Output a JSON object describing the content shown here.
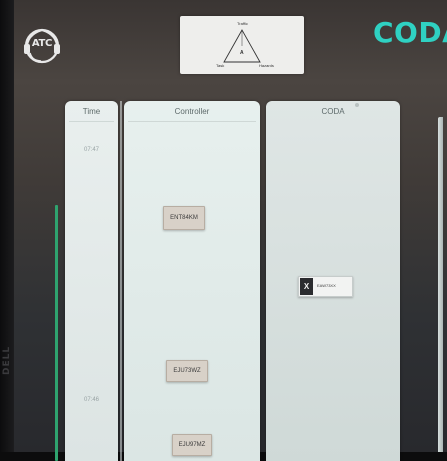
{
  "app": {
    "logo_text": "ATC",
    "title": "CODA"
  },
  "triangle": {
    "top_label": "Traffic",
    "left_label": "Task",
    "right_label": "Hazards",
    "center_label": "A"
  },
  "panels": {
    "time": {
      "header": "Time",
      "labels": [
        "07:47",
        "07:46"
      ]
    },
    "controller": {
      "header": "Controller",
      "strips": [
        "ENT84KM",
        "EJU73WZ",
        "EJU97MZ"
      ]
    },
    "coda": {
      "header": "CODA",
      "strip": {
        "action": "X",
        "callsign": "EAW73XX"
      }
    }
  },
  "bezel": {
    "brand": "DELL"
  },
  "colors": {
    "accent": "#2fd1c2",
    "timeline": "#2fa36f",
    "strip": "#d8d1c8"
  }
}
